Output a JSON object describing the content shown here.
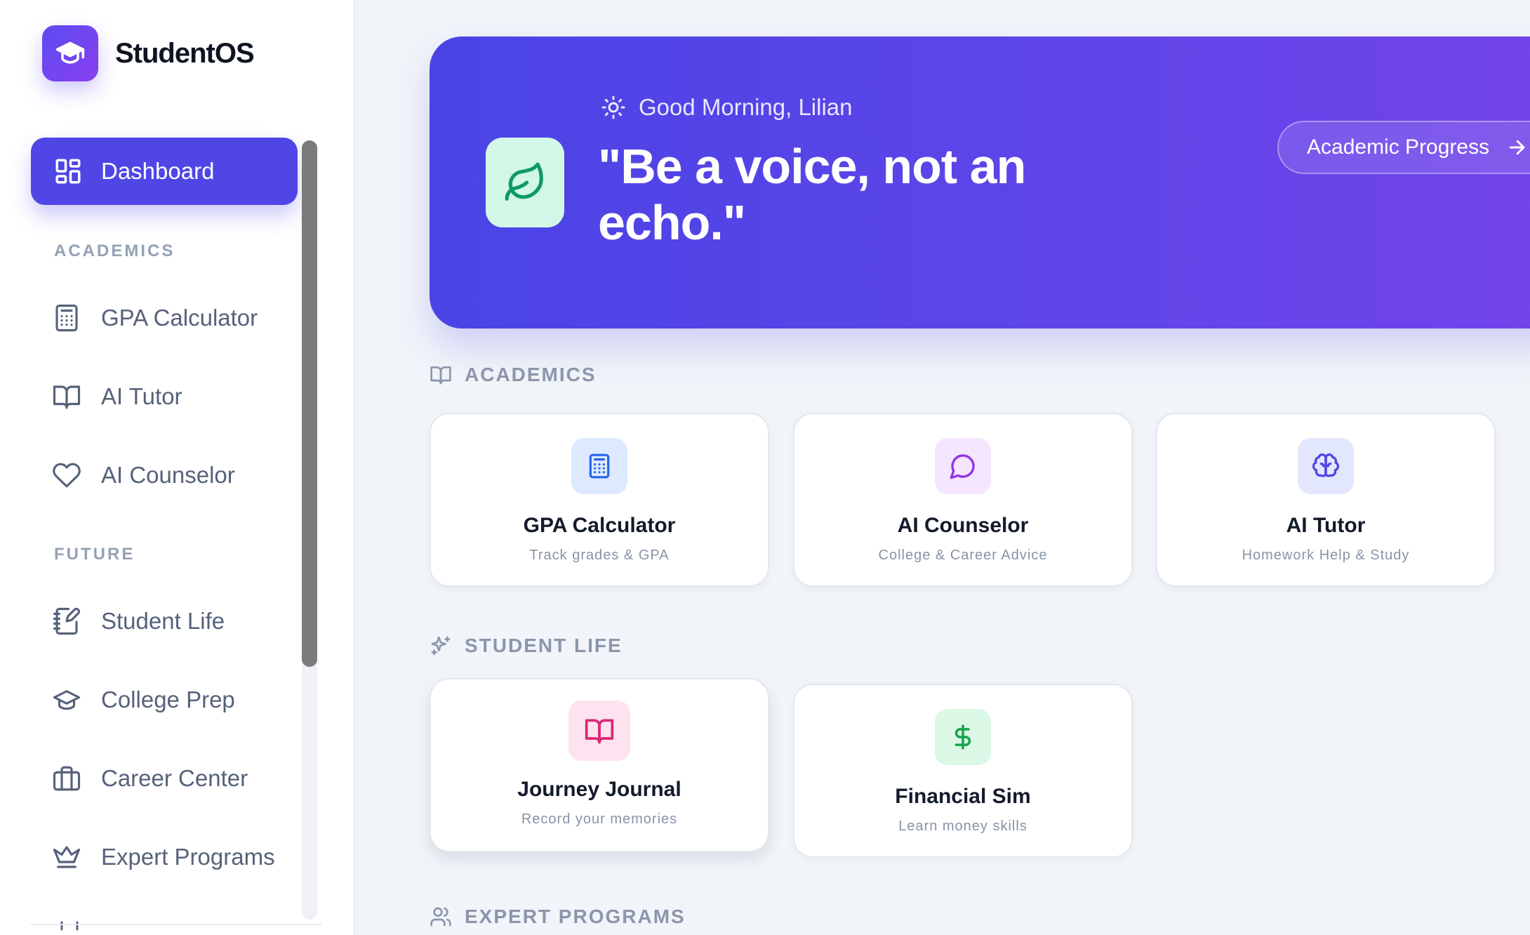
{
  "app": {
    "name": "StudentOS"
  },
  "sidebar": {
    "active_item": {
      "label": "Dashboard",
      "icon": "layout-grid-icon"
    },
    "sections": [
      {
        "title": "ACADEMICS",
        "items": [
          {
            "label": "GPA Calculator",
            "icon": "calculator-icon"
          },
          {
            "label": "AI Tutor",
            "icon": "book-open-icon"
          },
          {
            "label": "AI Counselor",
            "icon": "heart-icon"
          }
        ]
      },
      {
        "title": "FUTURE",
        "items": [
          {
            "label": "Student Life",
            "icon": "notebook-pen-icon"
          },
          {
            "label": "College Prep",
            "icon": "graduation-cap-icon"
          },
          {
            "label": "Career Center",
            "icon": "briefcase-icon"
          },
          {
            "label": "Expert Programs",
            "icon": "crown-icon"
          }
        ]
      }
    ]
  },
  "hero": {
    "greeting": "Good Morning, Lilian",
    "quote": "\"Be a voice, not an echo.\"",
    "button_label": "Academic Progress",
    "colors": {
      "start": "#4a44e5",
      "end": "#7344ea",
      "leaf_bg": "#d2f7e6",
      "leaf": "#0f9a63"
    }
  },
  "sections": {
    "academics": {
      "title": "ACADEMICS",
      "cards": [
        {
          "title": "GPA Calculator",
          "subtitle": "Track grades & GPA",
          "icon": "calculator-icon",
          "color": "#2563eb"
        },
        {
          "title": "AI Counselor",
          "subtitle": "College & Career Advice",
          "icon": "message-circle-icon",
          "color": "#9333ea"
        },
        {
          "title": "AI Tutor",
          "subtitle": "Homework Help & Study",
          "icon": "brain-icon",
          "color": "#4f46e5"
        }
      ]
    },
    "student_life": {
      "title": "STUDENT LIFE",
      "cards": [
        {
          "title": "Journey Journal",
          "subtitle": "Record your memories",
          "icon": "book-open-icon",
          "color": "#db2777"
        },
        {
          "title": "Financial Sim",
          "subtitle": "Learn money skills",
          "icon": "dollar-sign-icon",
          "color": "#16a34a"
        }
      ]
    },
    "expert_programs": {
      "title": "EXPERT PROGRAMS"
    }
  }
}
